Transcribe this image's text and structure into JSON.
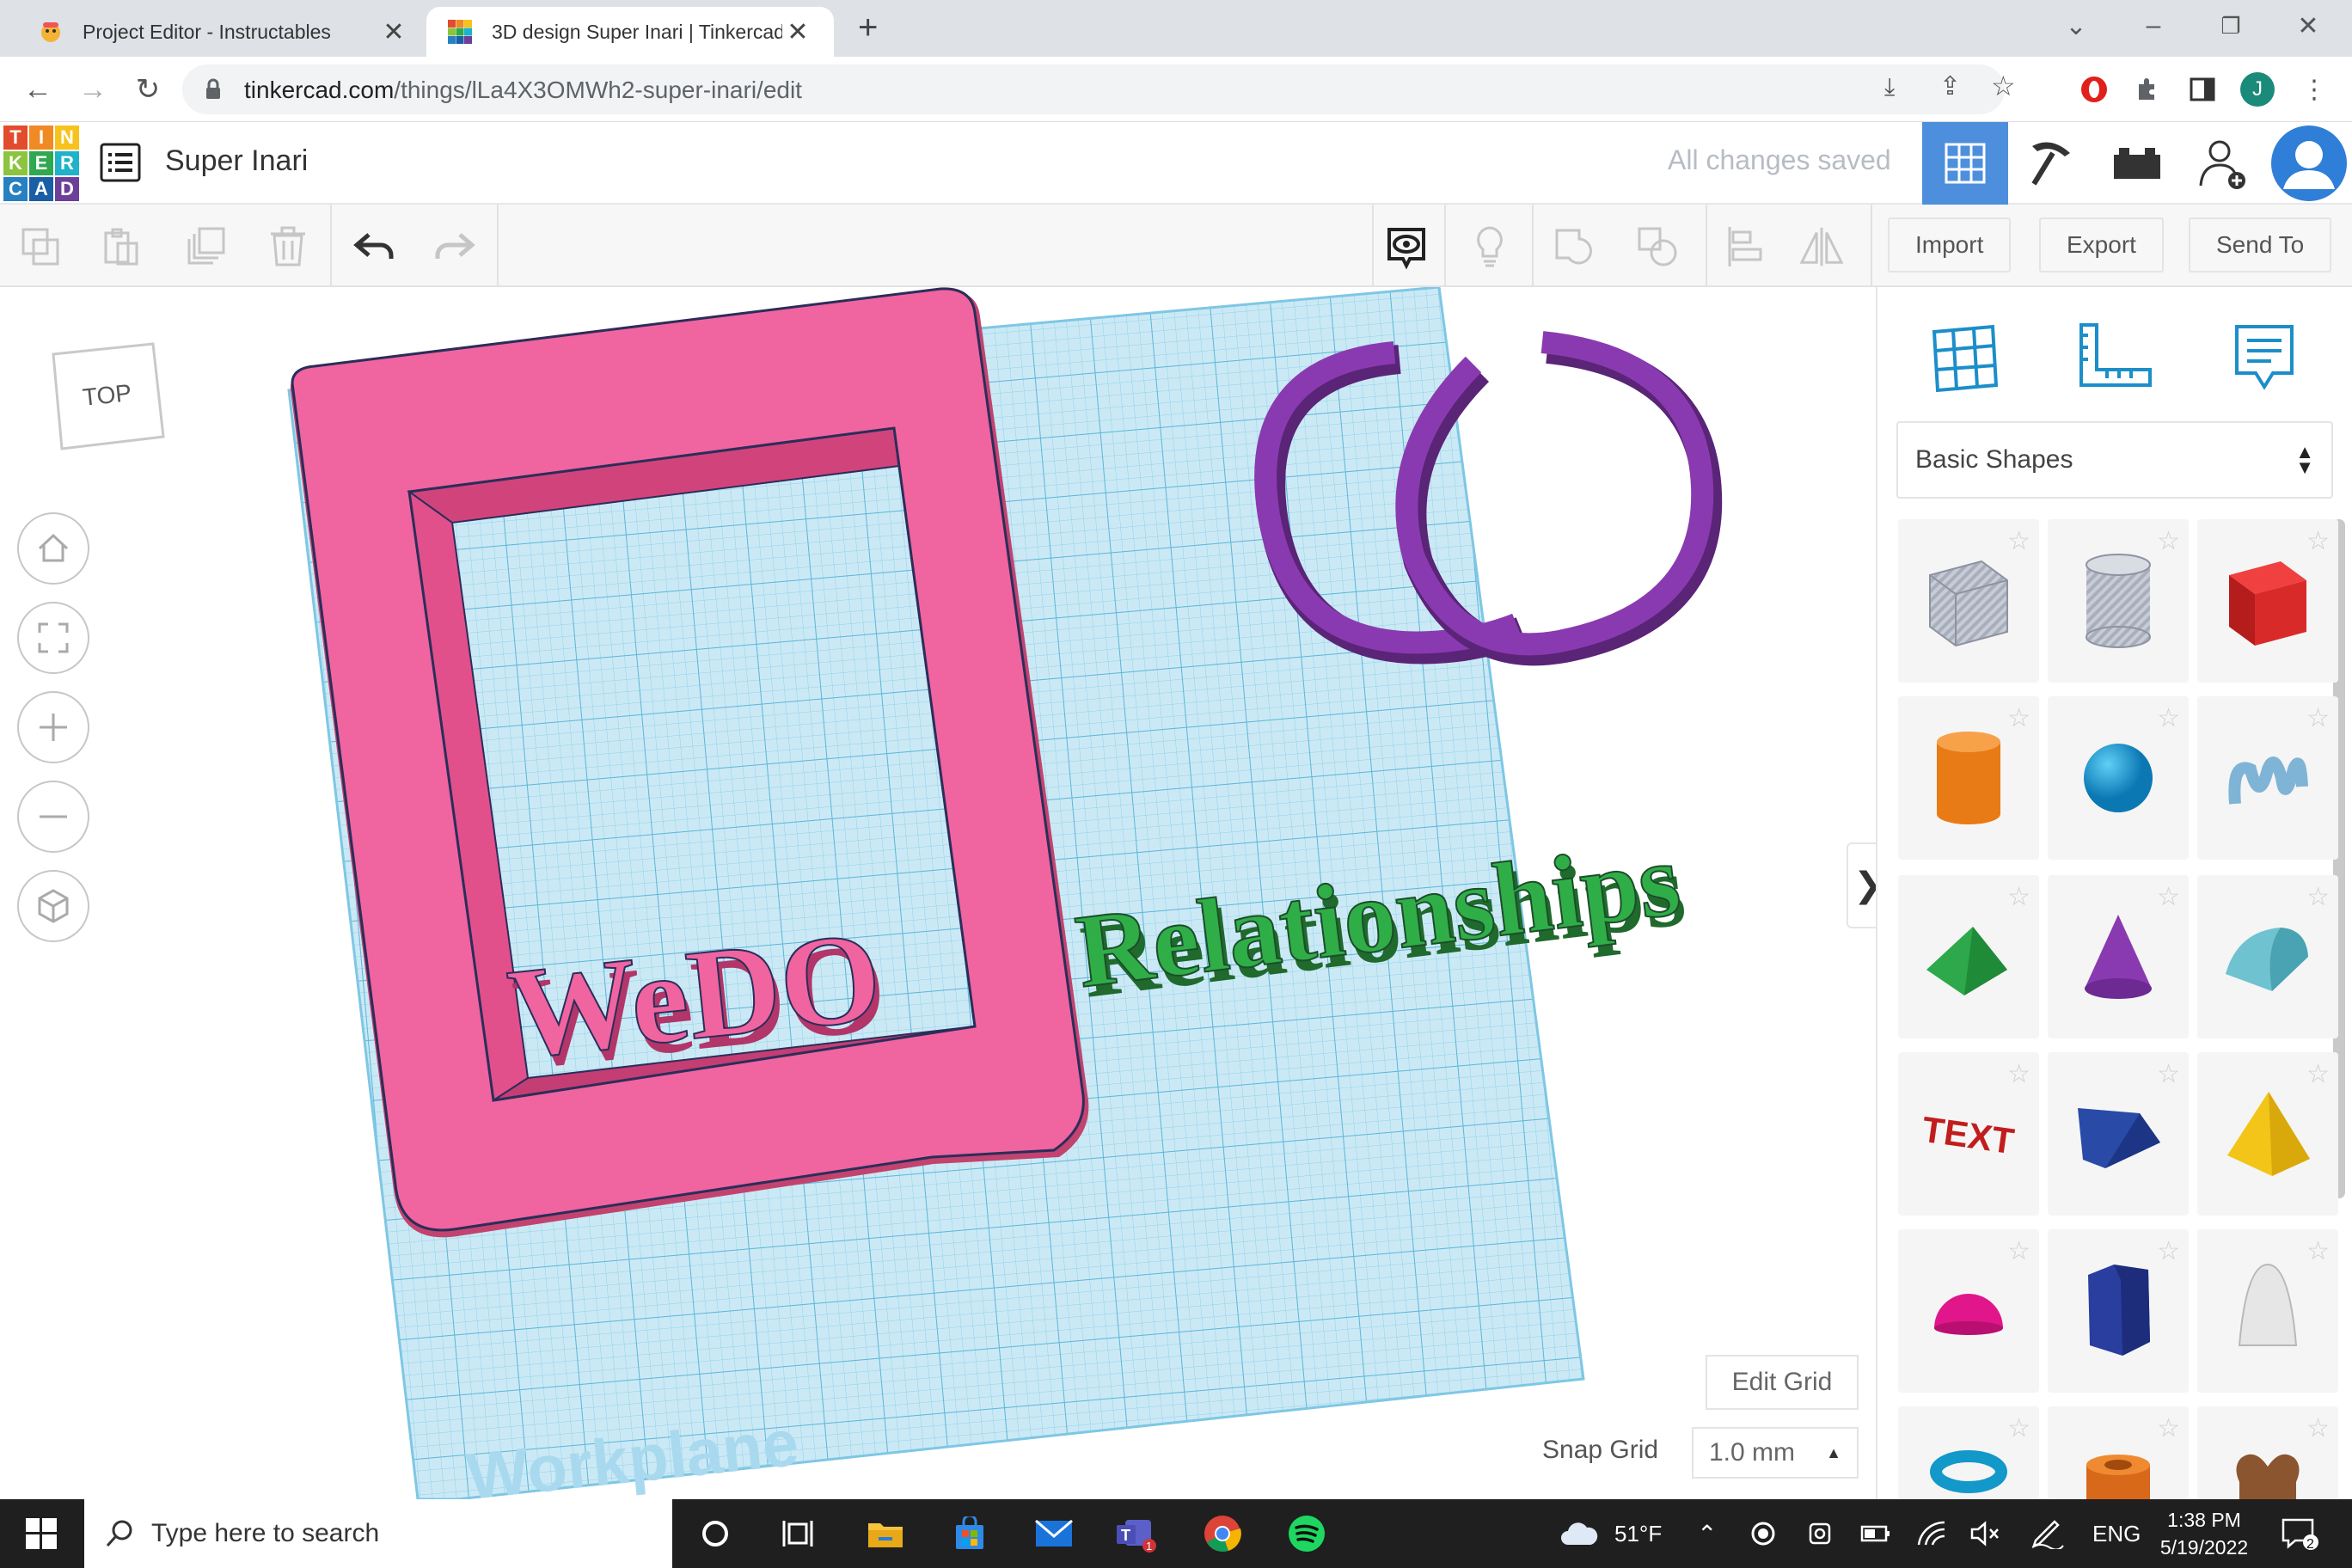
{
  "browser": {
    "tabs": [
      {
        "title": "Project Editor - Instructables",
        "active": false
      },
      {
        "title": "3D design Super Inari | Tinkercad",
        "active": true
      }
    ],
    "url_host": "tinkercad.com",
    "url_path": "/things/lLa4X3OMWh2-super-inari/edit",
    "profile_initial": "J"
  },
  "tinkercad": {
    "logo_letters": [
      "T",
      "I",
      "N",
      "K",
      "E",
      "R",
      "C",
      "A",
      "D"
    ],
    "design_title": "Super Inari",
    "save_status": "All changes saved",
    "toolbar": {
      "import_label": "Import",
      "export_label": "Export",
      "send_to_label": "Send To"
    },
    "viewcube_label": "TOP",
    "scene": {
      "text_relationships": "Relationships",
      "text_wedo": "WeDO",
      "workplane_label": "Workplane"
    },
    "panel": {
      "library_selected": "Basic Shapes",
      "shapes": [
        "Box",
        "Cylinder (hole)",
        "Box",
        "Cylinder",
        "Sphere",
        "Scribble",
        "Roof",
        "Cone",
        "Round Roof",
        "Text",
        "Wedge",
        "Pyramid",
        "Half Sphere",
        "Polygon",
        "Paraboloid",
        "Torus",
        "Tube",
        "Heart"
      ]
    },
    "edit_grid_label": "Edit Grid",
    "snap_grid_label": "Snap Grid",
    "snap_grid_value": "1.0 mm"
  },
  "taskbar": {
    "search_placeholder": "Type here to search",
    "weather": "51°F",
    "language": "ENG",
    "time": "1:38 PM",
    "date": "5/19/2022",
    "notification_count": "2"
  }
}
